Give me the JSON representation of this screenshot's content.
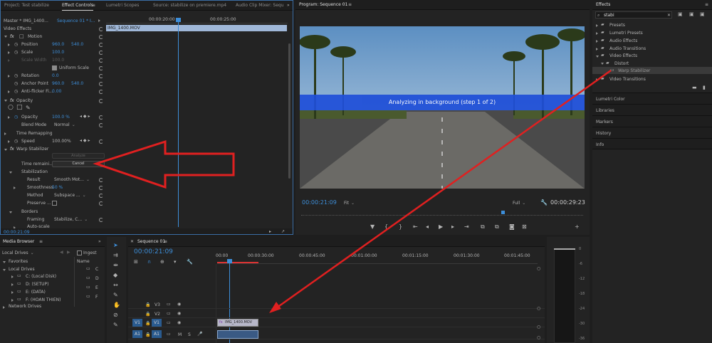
{
  "effect_controls": {
    "tabs": [
      "Project: Test stabilize",
      "Effect Controls",
      "Lumetri Scopes",
      "Source: stabilize on premiere.mp4",
      "Audio Clip Mixer: Sequ"
    ],
    "master_label": "Master * IMG_1400...",
    "sequence_label": "Sequence 01 * I...",
    "ruler": [
      "00:00:20:00",
      "00:00:25:00"
    ],
    "clip_name": "IMG_1400.MOV",
    "video_effects": "Video Effects",
    "motion": "Motion",
    "position_label": "Position",
    "position_x": "960.0",
    "position_y": "540.0",
    "scale_label": "Scale",
    "scale_value": "100.0",
    "scale_width_label": "Scale Width",
    "scale_width_value": "100.0",
    "uniform_scale": "Uniform Scale",
    "rotation_label": "Rotation",
    "rotation_value": "0.0",
    "anchor_label": "Anchor Point",
    "anchor_x": "960.0",
    "anchor_y": "540.0",
    "antiflicker_label": "Anti-flicker Fi...",
    "antiflicker_value": "0.00",
    "opacity_section": "Opacity",
    "opacity_label": "Opacity",
    "opacity_value": "100.0 %",
    "blend_label": "Blend Mode",
    "blend_value": "Normal",
    "time_remap": "Time Remapping",
    "speed_label": "Speed",
    "speed_value": "100.00%",
    "warp": "Warp Stabilizer",
    "analyze": "Analyze",
    "time_remaining": "Time remaini...",
    "cancel": "Cancel",
    "stabilization": "Stabilization",
    "result_label": "Result",
    "result_value": "Smooth Mot...",
    "smoothness_label": "Smoothness",
    "smoothness_value": "50 %",
    "method_label": "Method",
    "method_value": "Subspace ...",
    "preserve_label": "Preserve ...",
    "borders": "Borders",
    "framing_label": "Framing",
    "framing_value": "Stabilize, C...",
    "autoscale_label": "Auto-scale",
    "timecode": "00:00:21:09"
  },
  "program": {
    "title": "Program: Sequence 01",
    "overlay": "Analyzing in background (step 1 of 2)",
    "timecode": "00:00:21:09",
    "fit": "Fit",
    "quality": "Full",
    "duration": "00:00:29:23"
  },
  "effects": {
    "title": "Effects",
    "search": "stabi",
    "items": [
      "Presets",
      "Lumetri Presets",
      "Audio Effects",
      "Audio Transitions",
      "Video Effects",
      "Distort",
      "Warp Stabilizer",
      "Video Transitions"
    ],
    "collapsed": [
      "Lumetri Color",
      "Libraries",
      "Markers",
      "History",
      "Info"
    ]
  },
  "media_browser": {
    "title": "Media Browser",
    "location": "Local Drives",
    "ingest": "Ingest",
    "name_header": "Name",
    "favorites": "Favorites",
    "local_drives": "Local Drives",
    "drives": [
      "C: (Local Disk)",
      "D: (SETUP)",
      "E: (DATA)",
      "F: (HOAN THIEN)"
    ],
    "drive_letters": [
      "C",
      "D",
      "E",
      "F"
    ],
    "network": "Network Drives"
  },
  "timeline": {
    "title": "Sequence 01",
    "timecode": "00:00:21:09",
    "ruler": [
      "00:00",
      "00:00:30:00",
      "00:00:45:00",
      "00:01:00:00",
      "00:01:15:00",
      "00:01:30:00",
      "00:01:45:00"
    ],
    "tracks": [
      "V3",
      "V2",
      "V1",
      "A1"
    ],
    "src_v1": "V1",
    "src_a1": "A1",
    "clip_name": "IMG_1400.MOV",
    "m": "M",
    "s": "S"
  },
  "meter": {
    "ticks": [
      "0",
      "-6",
      "-12",
      "-18",
      "-24",
      "-30",
      "-36"
    ]
  },
  "colors": {
    "accent_blue": "#3d8ed9",
    "overlay_blue": "#1f4fd8",
    "annotation_red": "#e02020"
  }
}
